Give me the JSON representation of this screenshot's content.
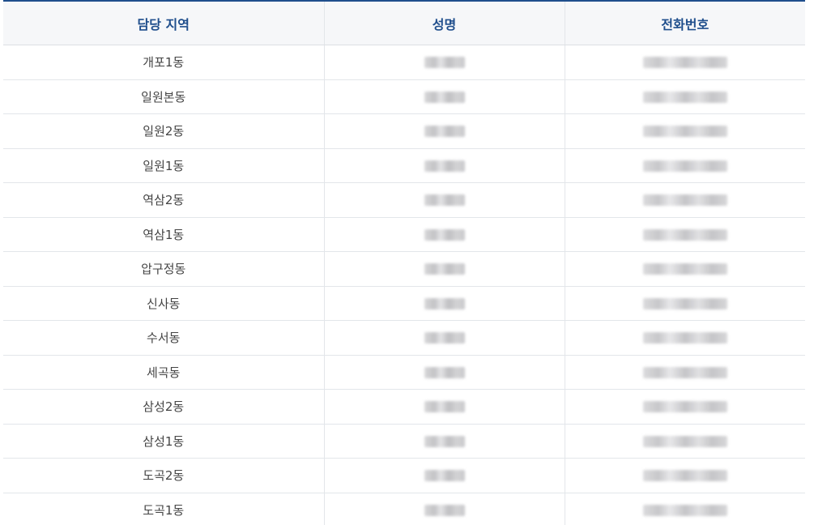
{
  "table": {
    "headers": [
      "담당 지역",
      "성명",
      "전화번호"
    ],
    "rows": [
      {
        "region": "개포1동"
      },
      {
        "region": "일원본동"
      },
      {
        "region": "일원2동"
      },
      {
        "region": "일원1동"
      },
      {
        "region": "역삼2동"
      },
      {
        "region": "역삼1동"
      },
      {
        "region": "압구정동"
      },
      {
        "region": "신사동"
      },
      {
        "region": "수서동"
      },
      {
        "region": "세곡동"
      },
      {
        "region": "삼성2동"
      },
      {
        "region": "삼성1동"
      },
      {
        "region": "도곡2동"
      },
      {
        "region": "도곡1동"
      }
    ]
  },
  "colors": {
    "header_text": "#1f4e8c",
    "header_bg": "#f6f7f9",
    "top_border": "#1f4e8c",
    "cell_text": "#444444",
    "grid_line": "#e3e6ea"
  }
}
